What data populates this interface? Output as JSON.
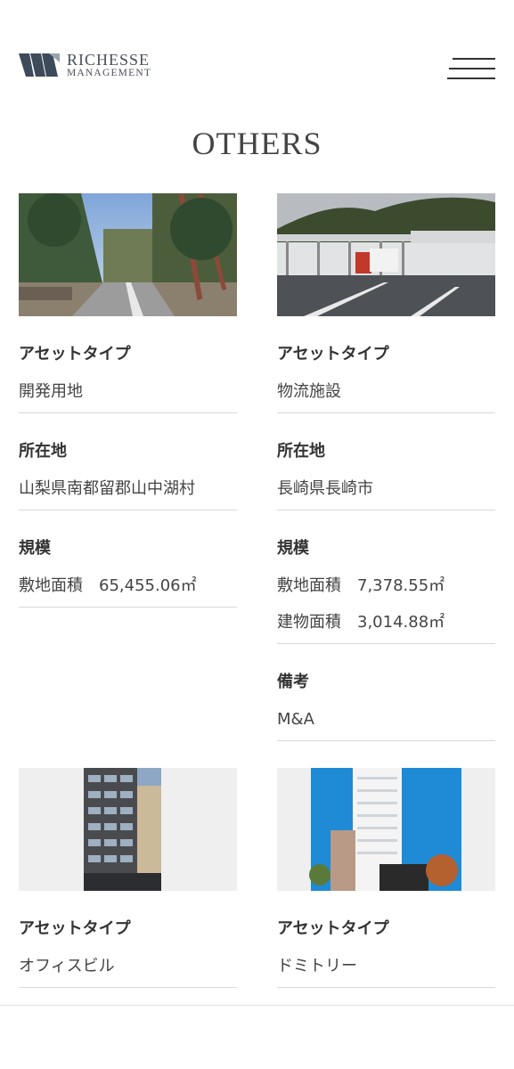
{
  "header": {
    "logo_line1": "RICHESSE",
    "logo_line2": "MANAGEMENT",
    "menu_icon": "hamburger-icon",
    "brand_color": "#3d4a5a"
  },
  "page_title": "OTHERS",
  "properties": [
    {
      "image": "tree-lined-road-photo",
      "asset_type_label": "アセットタイプ",
      "asset_type": "開発用地",
      "location_label": "所在地",
      "location": "山梨県南都留郡山中湖村",
      "scale_label": "規模",
      "scale": [
        "敷地面積　65,455.06㎡"
      ]
    },
    {
      "image": "logistics-warehouse-photo",
      "asset_type_label": "アセットタイプ",
      "asset_type": "物流施設",
      "location_label": "所在地",
      "location": "長崎県長崎市",
      "scale_label": "規模",
      "scale": [
        "敷地面積　7,378.55㎡",
        "建物面積　3,014.88㎡"
      ],
      "remarks_label": "備考",
      "remarks": "M&A"
    },
    {
      "image": "office-building-photo",
      "asset_type_label": "アセットタイプ",
      "asset_type": "オフィスビル"
    },
    {
      "image": "dormitory-building-photo",
      "asset_type_label": "アセットタイプ",
      "asset_type": "ドミトリー"
    }
  ]
}
